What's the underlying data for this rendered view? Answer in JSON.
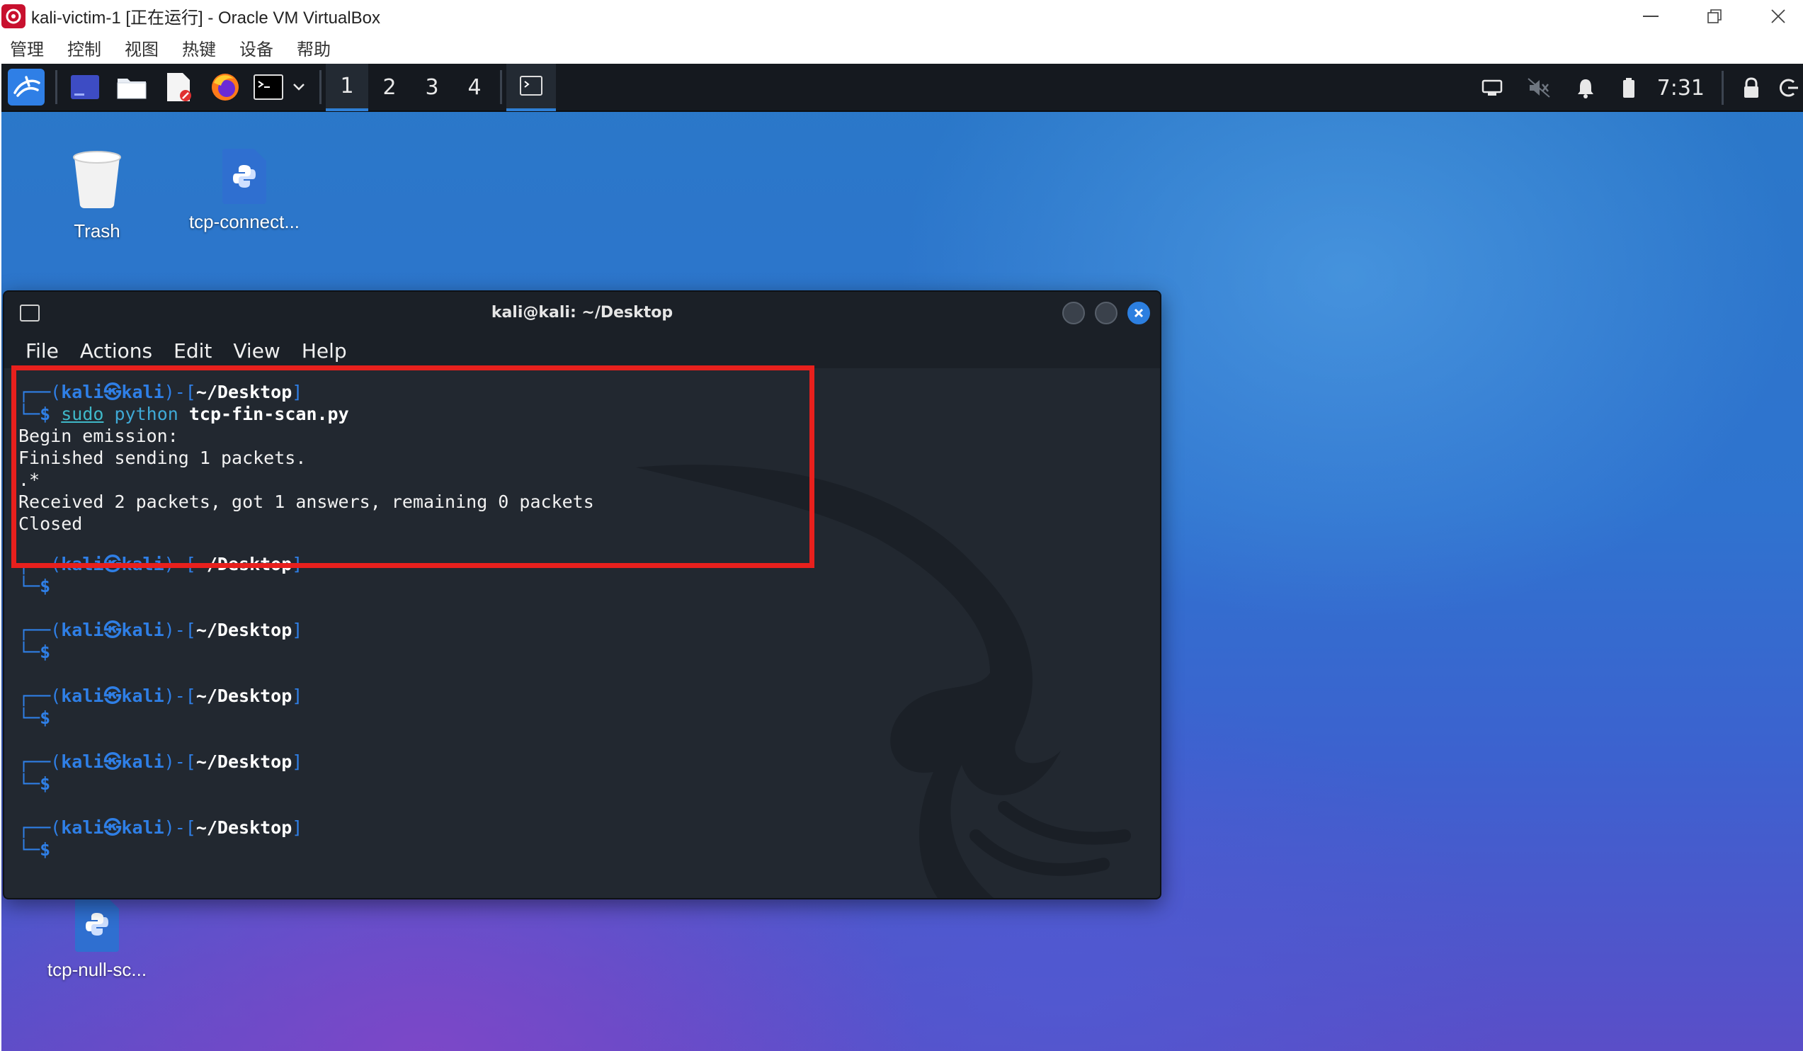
{
  "vbox": {
    "title": "kali-victim-1 [正在运行] - Oracle VM VirtualBox",
    "menu": [
      "管理",
      "控制",
      "视图",
      "热键",
      "设备",
      "帮助"
    ]
  },
  "panel": {
    "workspaces": [
      "1",
      "2",
      "3",
      "4"
    ],
    "active_workspace": "1",
    "clock": "7:31"
  },
  "desktop": {
    "icons": [
      {
        "label": "Trash",
        "icon": "trash-icon"
      },
      {
        "label": "tcp-connect...",
        "icon": "python-file-icon"
      },
      {
        "label": "tcp-null-sc...",
        "icon": "python-file-icon"
      }
    ]
  },
  "terminal": {
    "title": "kali@kali: ~/Desktop",
    "menu": [
      "File",
      "Actions",
      "Edit",
      "View",
      "Help"
    ],
    "prompt_user": "kali",
    "prompt_at": "㉿",
    "prompt_host": "kali",
    "prompt_path": "~/Desktop",
    "command_sudo": "sudo",
    "command_python": "python",
    "command_file": "tcp-fin-scan.py",
    "output": [
      "Begin emission:",
      "Finished sending 1 packets.",
      ".*",
      "Received 2 packets, got 1 answers, remaining 0 packets",
      "Closed"
    ],
    "empty_prompts": 5,
    "highlight_color": "#e8201d"
  },
  "colors": {
    "accent": "#2f7fe6",
    "terminal_bg": "#222830",
    "panel_bg": "#15191f"
  }
}
